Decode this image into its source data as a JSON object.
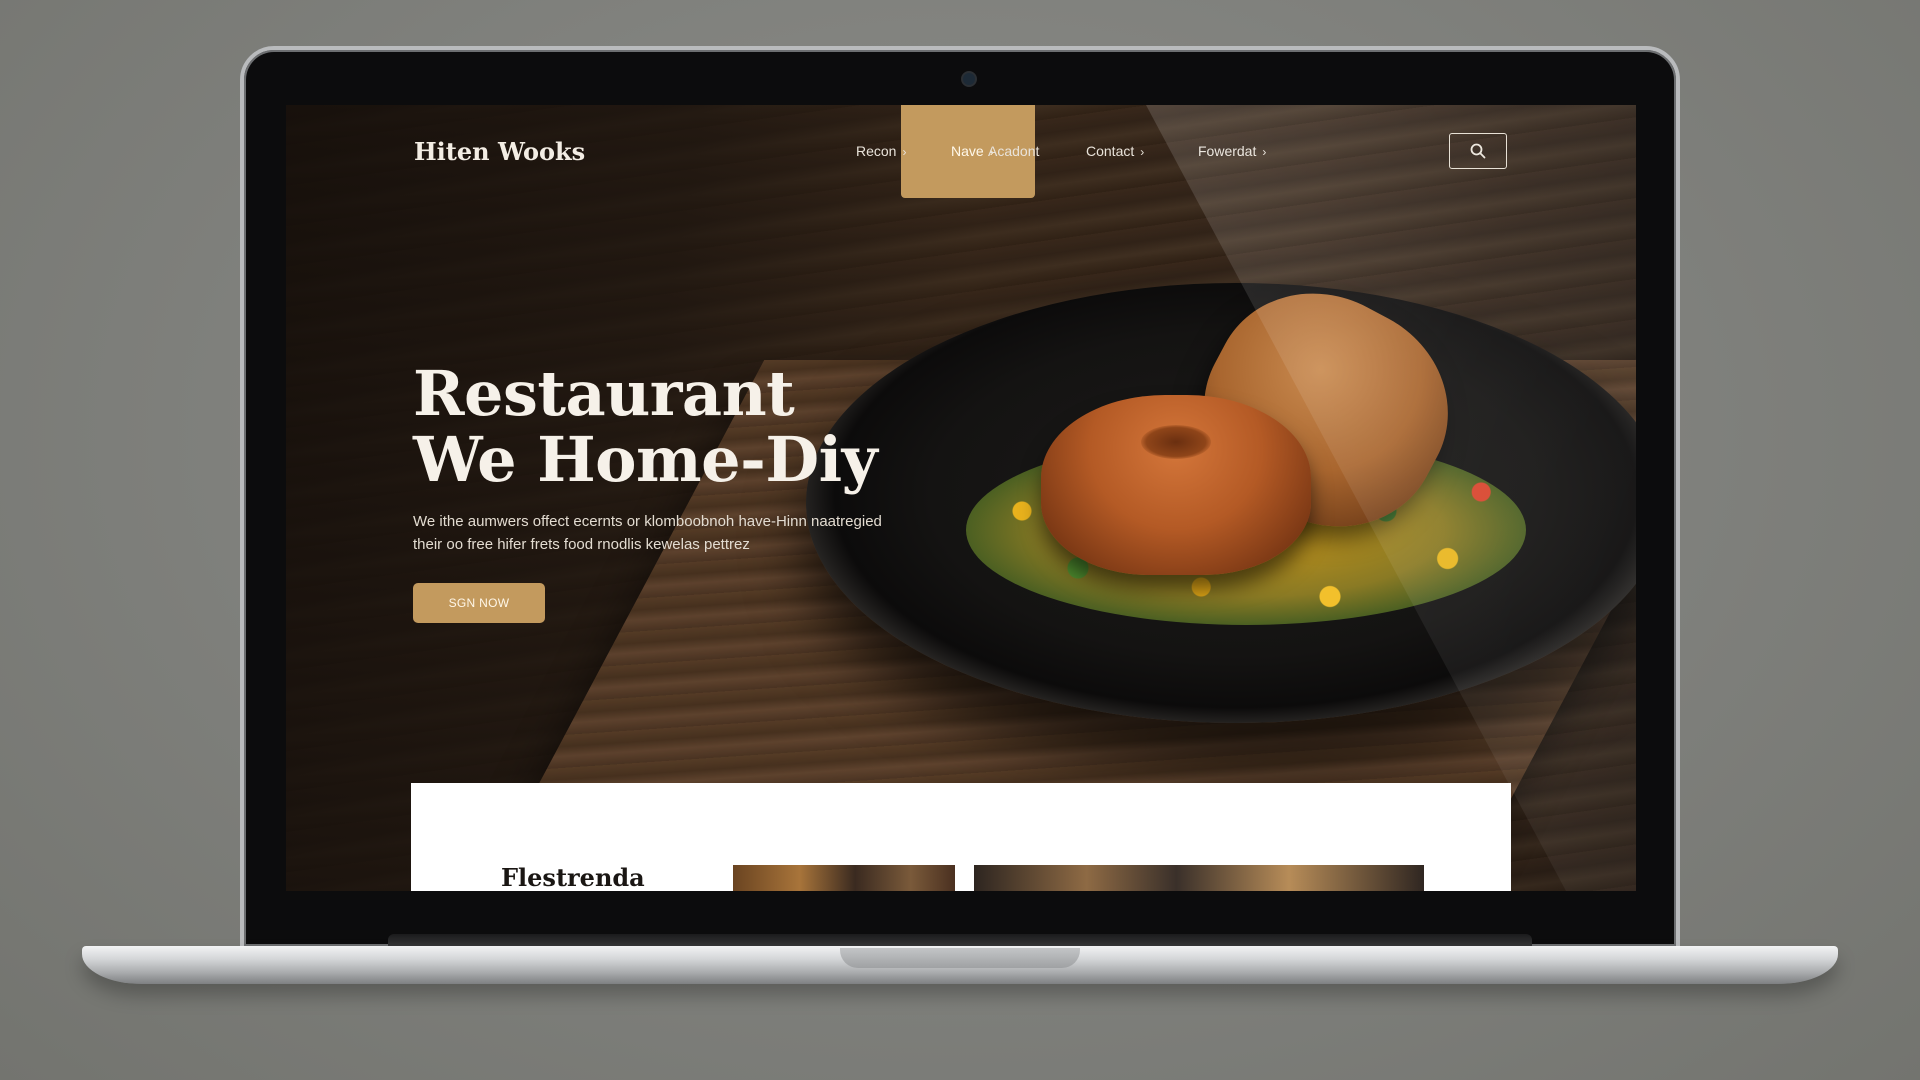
{
  "site": {
    "brand": "Hiten Wooks",
    "nav": [
      {
        "label": "Nave",
        "chevron": "›",
        "active": true
      },
      {
        "label": "Recon",
        "chevron": "›"
      },
      {
        "label": "Acadont",
        "chevron": ""
      },
      {
        "label": "Contact",
        "chevron": "›"
      },
      {
        "label": "Fowerdat",
        "chevron": "›"
      }
    ],
    "search_icon": "search-icon"
  },
  "hero": {
    "title_line1": "Restaurant",
    "title_line2": "We Home-Diy",
    "desc_line1": "We ithe aumwers offect ecernts or klomboobnoh have-Hinn naatregied",
    "desc_line2": "their oo free hifer frets food rnodlis kewelas pettrez",
    "cta_label": "SGN NOW"
  },
  "featured": {
    "title": "Flestrenda"
  },
  "colors": {
    "accent": "#c39a5e",
    "background": "#2a1e15",
    "text": "#f6f1e9"
  }
}
